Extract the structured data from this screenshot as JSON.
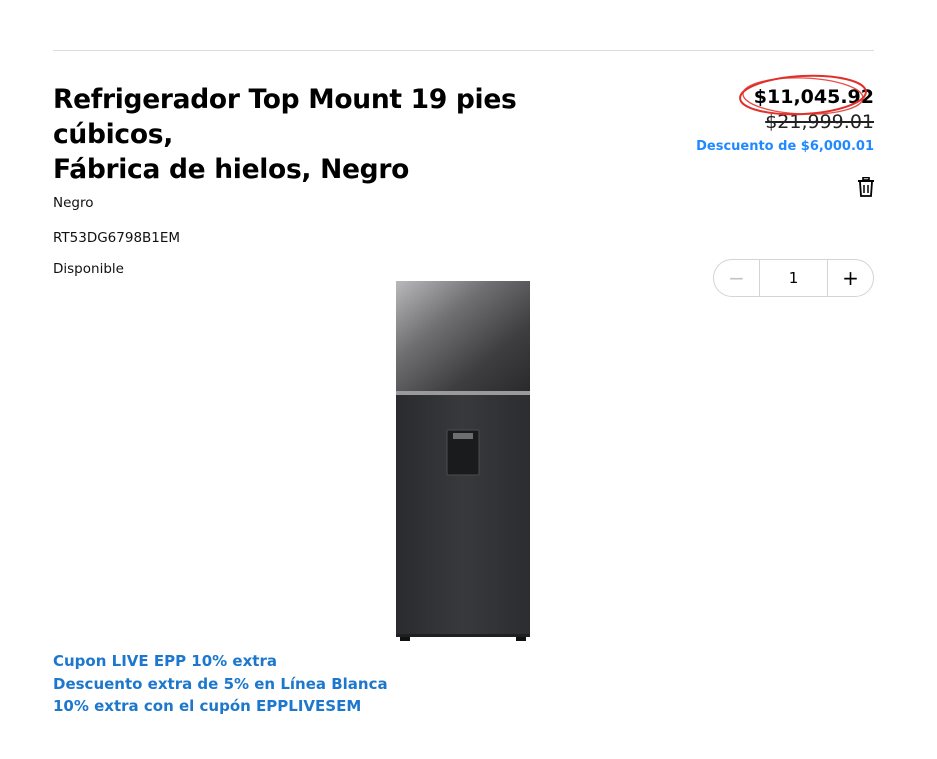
{
  "product": {
    "title_line1": "Refrigerador Top Mount 19 pies cúbicos,",
    "title_line2": "Fábrica de hielos, Negro",
    "color": "Negro",
    "sku": "RT53DG6798B1EM",
    "availability": "Disponible",
    "image_icon": "refrigerator-image"
  },
  "pricing": {
    "current_price": "$11,045.92",
    "original_price": "$21,999.01",
    "discount_text": "Descuento de $6,000.01",
    "highlight_color": "#e0302a",
    "discount_color": "#2189ff"
  },
  "quantity": {
    "minus_label": "−",
    "value": "1",
    "plus_label": "+"
  },
  "actions": {
    "remove_icon": "trash-icon"
  },
  "promotions": [
    {
      "label": "Cupon LIVE EPP 10% extra"
    },
    {
      "label": "Descuento extra de 5% en Línea Blanca"
    },
    {
      "label": "10% extra con el cupón EPPLIVESEM"
    }
  ],
  "colors": {
    "promo_link": "#1d77cc",
    "divider": "#dddddd"
  }
}
